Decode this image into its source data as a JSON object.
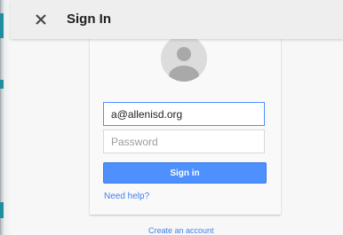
{
  "header": {
    "title": "Sign In",
    "close_icon": "close-icon"
  },
  "form": {
    "avatar_icon": "default-avatar-icon",
    "email_value": "a@allenisd.org",
    "password_placeholder": "Password",
    "signin_label": "Sign in",
    "help_link": "Need help?"
  },
  "footer": {
    "create_account": "Create an account"
  },
  "colors": {
    "accent": "#4d90fe",
    "link": "#427fed",
    "header_bg": "#eeeeee",
    "page_bg": "#f7f7f7"
  }
}
